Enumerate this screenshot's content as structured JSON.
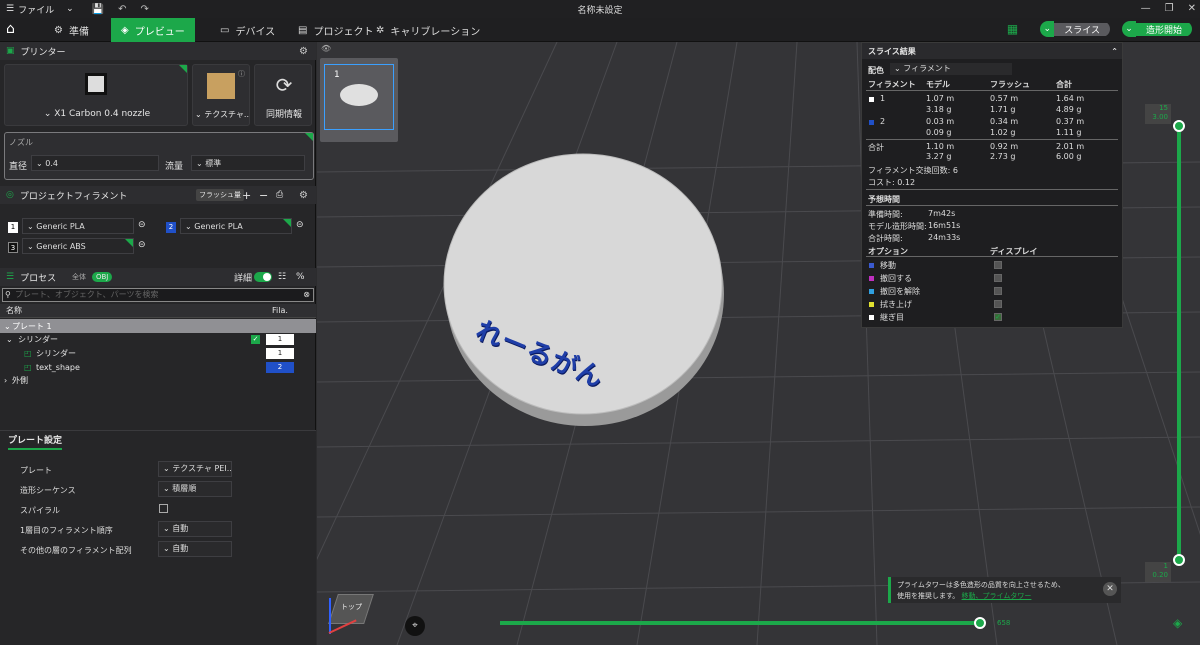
{
  "titlebar": {
    "menu_label": "ファイル",
    "window_title": "名称未設定"
  },
  "tabs": [
    {
      "label": "準備"
    },
    {
      "label": "プレビュー"
    },
    {
      "label": "デバイス"
    },
    {
      "label": "プロジェクト"
    },
    {
      "label": "キャリブレーション"
    }
  ],
  "actions": {
    "slice_label": "スライス",
    "print_label": "造形開始"
  },
  "printer": {
    "section_title": "プリンター",
    "printer_name": "X1 Carbon 0.4 nozzle",
    "plate_name": "テクスチャ...",
    "sync_label": "同期情報"
  },
  "nozzle": {
    "section_title": "ノズル",
    "diameter_label": "直径",
    "diameter_value": "0.4",
    "flow_label": "流量",
    "flow_value": "標準"
  },
  "filament": {
    "section_title": "プロジェクトフィラメント",
    "flush_label": "フラッシュ量",
    "items": [
      {
        "num": "1",
        "name": "Generic PLA",
        "color": "#ffffff"
      },
      {
        "num": "2",
        "name": "Generic PLA",
        "color": "#2050c8"
      },
      {
        "num": "3",
        "name": "Generic ABS",
        "color": "#1a1a1a"
      }
    ]
  },
  "process": {
    "section_title": "プロセス",
    "global_label": "全体",
    "obj_label": "OBJ",
    "detail_label": "詳細",
    "search_placeholder": "プレート、オブジェクト、パーツを検索",
    "col_name": "名称",
    "col_fila": "Fila.",
    "tree": [
      {
        "label": "プレート 1",
        "fila": ""
      },
      {
        "label": "シリンダー",
        "fila": "1"
      },
      {
        "label": "シリンダー",
        "fila": "1"
      },
      {
        "label": "text_shape",
        "fila": "2"
      },
      {
        "label": "外側",
        "fila": ""
      }
    ]
  },
  "plate_settings": {
    "tab_label": "プレート設定",
    "rows": [
      {
        "label": "プレート",
        "value": "テクスチャ PEI..."
      },
      {
        "label": "造形シーケンス",
        "value": "積層順"
      },
      {
        "label": "スパイラル",
        "value": ""
      },
      {
        "label": "1層目のフィラメント順序",
        "value": "自動"
      },
      {
        "label": "その他の層のフィラメント配列",
        "value": "自動"
      }
    ]
  },
  "viewport": {
    "plate_thumb_num": "1",
    "model_text": "れーるがん",
    "layer_top": "15",
    "layer_top_h": "3.00",
    "layer_bottom": "1",
    "layer_bottom_h": "0.20",
    "move_value": "658",
    "gizmo_label": "トップ"
  },
  "slice_results": {
    "title": "スライス結果",
    "scheme_label": "配色",
    "scheme_value": "フィラメント",
    "headers": [
      "フィラメント",
      "モデル",
      "フラッシュ",
      "合計"
    ],
    "rows": [
      {
        "num": "1",
        "color": "#ffffff",
        "model": [
          "1.07 m",
          "3.18 g"
        ],
        "flush": [
          "0.57 m",
          "1.71 g"
        ],
        "total": [
          "1.64 m",
          "4.89 g"
        ]
      },
      {
        "num": "2",
        "color": "#2050c8",
        "model": [
          "0.03 m",
          "0.09 g"
        ],
        "flush": [
          "0.34 m",
          "1.02 g"
        ],
        "total": [
          "0.37 m",
          "1.11 g"
        ]
      }
    ],
    "sum_label": "合計",
    "sum": {
      "model": [
        "1.10 m",
        "3.27 g"
      ],
      "flush": [
        "0.92 m",
        "2.73 g"
      ],
      "total": [
        "2.01 m",
        "6.00 g"
      ]
    },
    "change_count": "フィラメント交換回数:  6",
    "cost": "コスト:  0.12",
    "time_title": "予想時間",
    "prep_label": "準備時間:",
    "prep_value": "7m42s",
    "model_time_label": "モデル造形時間:",
    "model_time_value": "16m51s",
    "total_time_label": "合計時間:",
    "total_time_value": "24m33s",
    "options_title": "オプション",
    "display_title": "ディスプレイ",
    "options": [
      {
        "label": "移動",
        "color": "#3a5ad0",
        "checked": false
      },
      {
        "label": "撤回する",
        "color": "#c030c0",
        "checked": false
      },
      {
        "label": "撤回を解除",
        "color": "#30a0e0",
        "checked": false
      },
      {
        "label": "拭き上げ",
        "color": "#e0e030",
        "checked": false
      },
      {
        "label": "継ぎ目",
        "color": "#ffffff",
        "checked": true
      }
    ]
  },
  "notice": {
    "text1": "プライムタワーは多色造形の品質を向上させるため、",
    "text2": "使用を推奨します。",
    "link": "移動、プライムタワー"
  }
}
